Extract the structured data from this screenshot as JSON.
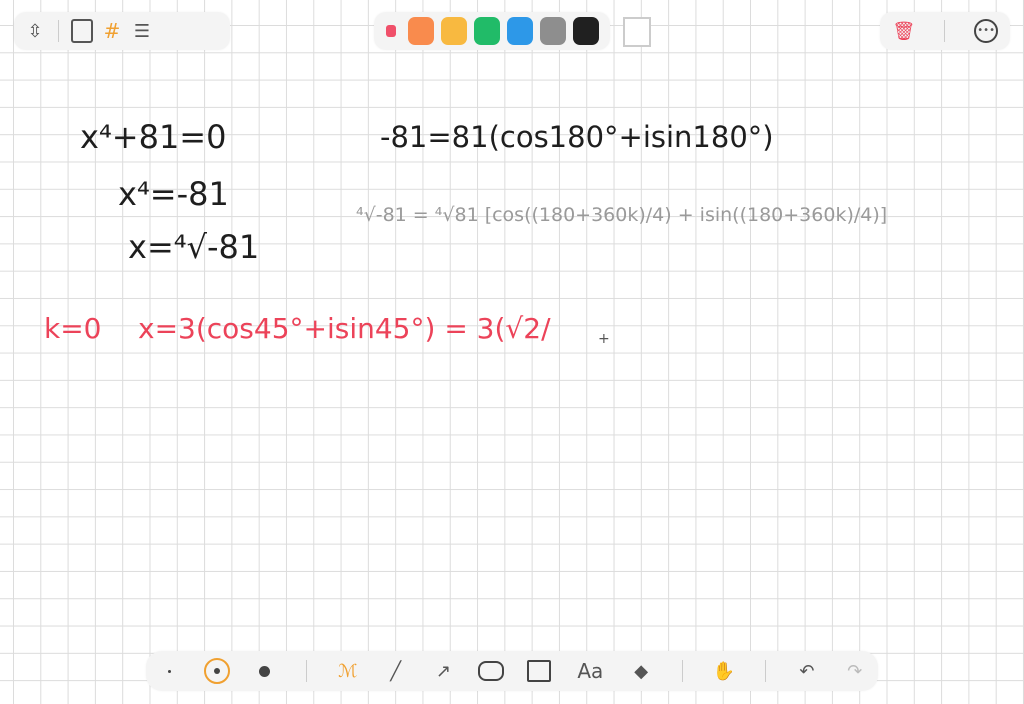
{
  "toolbar_top": {
    "left": [
      "resize-icon",
      "blank-page-icon",
      "grid-page-icon",
      "lined-page-icon"
    ],
    "colors": [
      "#f0506a",
      "#f98b4d",
      "#f8b940",
      "#21bb68",
      "#2d98e8",
      "#8e8e8e",
      "#202020",
      "#ffffff"
    ],
    "right": [
      "trash-icon",
      "more-icon"
    ]
  },
  "toolbar_bottom": {
    "tools": [
      "small-dot",
      "medium-dot",
      "large-dot",
      "pen",
      "line",
      "arrow",
      "ellipse",
      "rectangle",
      "text",
      "eraser",
      "hand",
      "undo",
      "redo"
    ],
    "text_tool_label": "Aa",
    "accent": "#f0a030"
  },
  "canvas": {
    "lines": [
      {
        "text": "x⁴+81=0",
        "color": "#1e1e1e"
      },
      {
        "text": "x⁴=-81",
        "color": "#1e1e1e"
      },
      {
        "text": "x=⁴√-81",
        "color": "#1e1e1e"
      },
      {
        "text": "-81=81(cos180°+isin180°)",
        "color": "#1e1e1e"
      },
      {
        "text": "⁴√-81 = ⁴√81 [cos((180+360k)/4) + isin((180+360k)/4)]",
        "color": "#9a9a9a"
      },
      {
        "text": "k=0",
        "color": "#ec4359"
      },
      {
        "text": "x=3(cos45°+isin45°) = 3(√2/",
        "color": "#ec4359"
      }
    ]
  }
}
